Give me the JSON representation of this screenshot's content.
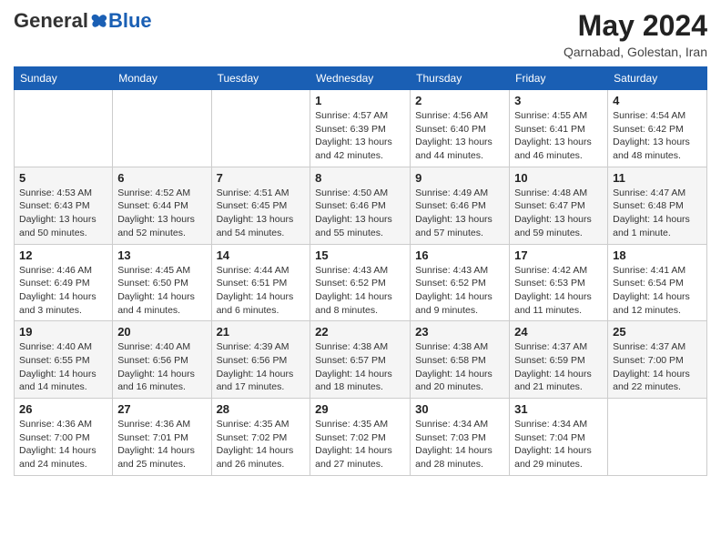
{
  "header": {
    "logo_general": "General",
    "logo_blue": "Blue",
    "month_year": "May 2024",
    "location": "Qarnabad, Golestan, Iran"
  },
  "weekdays": [
    "Sunday",
    "Monday",
    "Tuesday",
    "Wednesday",
    "Thursday",
    "Friday",
    "Saturday"
  ],
  "weeks": [
    [
      {
        "day": "",
        "info": ""
      },
      {
        "day": "",
        "info": ""
      },
      {
        "day": "",
        "info": ""
      },
      {
        "day": "1",
        "info": "Sunrise: 4:57 AM\nSunset: 6:39 PM\nDaylight: 13 hours\nand 42 minutes."
      },
      {
        "day": "2",
        "info": "Sunrise: 4:56 AM\nSunset: 6:40 PM\nDaylight: 13 hours\nand 44 minutes."
      },
      {
        "day": "3",
        "info": "Sunrise: 4:55 AM\nSunset: 6:41 PM\nDaylight: 13 hours\nand 46 minutes."
      },
      {
        "day": "4",
        "info": "Sunrise: 4:54 AM\nSunset: 6:42 PM\nDaylight: 13 hours\nand 48 minutes."
      }
    ],
    [
      {
        "day": "5",
        "info": "Sunrise: 4:53 AM\nSunset: 6:43 PM\nDaylight: 13 hours\nand 50 minutes."
      },
      {
        "day": "6",
        "info": "Sunrise: 4:52 AM\nSunset: 6:44 PM\nDaylight: 13 hours\nand 52 minutes."
      },
      {
        "day": "7",
        "info": "Sunrise: 4:51 AM\nSunset: 6:45 PM\nDaylight: 13 hours\nand 54 minutes."
      },
      {
        "day": "8",
        "info": "Sunrise: 4:50 AM\nSunset: 6:46 PM\nDaylight: 13 hours\nand 55 minutes."
      },
      {
        "day": "9",
        "info": "Sunrise: 4:49 AM\nSunset: 6:46 PM\nDaylight: 13 hours\nand 57 minutes."
      },
      {
        "day": "10",
        "info": "Sunrise: 4:48 AM\nSunset: 6:47 PM\nDaylight: 13 hours\nand 59 minutes."
      },
      {
        "day": "11",
        "info": "Sunrise: 4:47 AM\nSunset: 6:48 PM\nDaylight: 14 hours\nand 1 minute."
      }
    ],
    [
      {
        "day": "12",
        "info": "Sunrise: 4:46 AM\nSunset: 6:49 PM\nDaylight: 14 hours\nand 3 minutes."
      },
      {
        "day": "13",
        "info": "Sunrise: 4:45 AM\nSunset: 6:50 PM\nDaylight: 14 hours\nand 4 minutes."
      },
      {
        "day": "14",
        "info": "Sunrise: 4:44 AM\nSunset: 6:51 PM\nDaylight: 14 hours\nand 6 minutes."
      },
      {
        "day": "15",
        "info": "Sunrise: 4:43 AM\nSunset: 6:52 PM\nDaylight: 14 hours\nand 8 minutes."
      },
      {
        "day": "16",
        "info": "Sunrise: 4:43 AM\nSunset: 6:52 PM\nDaylight: 14 hours\nand 9 minutes."
      },
      {
        "day": "17",
        "info": "Sunrise: 4:42 AM\nSunset: 6:53 PM\nDaylight: 14 hours\nand 11 minutes."
      },
      {
        "day": "18",
        "info": "Sunrise: 4:41 AM\nSunset: 6:54 PM\nDaylight: 14 hours\nand 12 minutes."
      }
    ],
    [
      {
        "day": "19",
        "info": "Sunrise: 4:40 AM\nSunset: 6:55 PM\nDaylight: 14 hours\nand 14 minutes."
      },
      {
        "day": "20",
        "info": "Sunrise: 4:40 AM\nSunset: 6:56 PM\nDaylight: 14 hours\nand 16 minutes."
      },
      {
        "day": "21",
        "info": "Sunrise: 4:39 AM\nSunset: 6:56 PM\nDaylight: 14 hours\nand 17 minutes."
      },
      {
        "day": "22",
        "info": "Sunrise: 4:38 AM\nSunset: 6:57 PM\nDaylight: 14 hours\nand 18 minutes."
      },
      {
        "day": "23",
        "info": "Sunrise: 4:38 AM\nSunset: 6:58 PM\nDaylight: 14 hours\nand 20 minutes."
      },
      {
        "day": "24",
        "info": "Sunrise: 4:37 AM\nSunset: 6:59 PM\nDaylight: 14 hours\nand 21 minutes."
      },
      {
        "day": "25",
        "info": "Sunrise: 4:37 AM\nSunset: 7:00 PM\nDaylight: 14 hours\nand 22 minutes."
      }
    ],
    [
      {
        "day": "26",
        "info": "Sunrise: 4:36 AM\nSunset: 7:00 PM\nDaylight: 14 hours\nand 24 minutes."
      },
      {
        "day": "27",
        "info": "Sunrise: 4:36 AM\nSunset: 7:01 PM\nDaylight: 14 hours\nand 25 minutes."
      },
      {
        "day": "28",
        "info": "Sunrise: 4:35 AM\nSunset: 7:02 PM\nDaylight: 14 hours\nand 26 minutes."
      },
      {
        "day": "29",
        "info": "Sunrise: 4:35 AM\nSunset: 7:02 PM\nDaylight: 14 hours\nand 27 minutes."
      },
      {
        "day": "30",
        "info": "Sunrise: 4:34 AM\nSunset: 7:03 PM\nDaylight: 14 hours\nand 28 minutes."
      },
      {
        "day": "31",
        "info": "Sunrise: 4:34 AM\nSunset: 7:04 PM\nDaylight: 14 hours\nand 29 minutes."
      },
      {
        "day": "",
        "info": ""
      }
    ]
  ]
}
